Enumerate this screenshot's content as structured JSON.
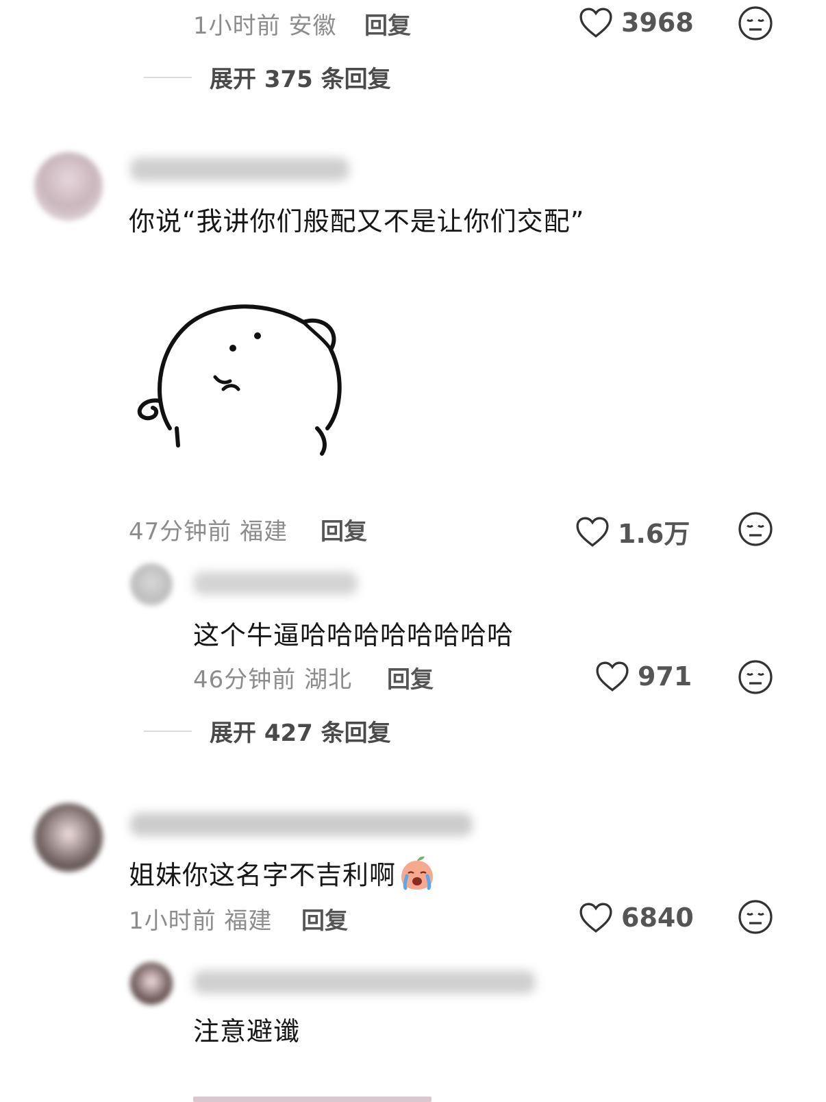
{
  "thread1": {
    "meta": "1小时前 安徽",
    "reply": "回复",
    "likes": "3968",
    "expand": "展开 375 条回复"
  },
  "comment2": {
    "text": "你说“我讲你们般配又不是让你们交配”",
    "meta": "47分钟前 福建",
    "reply": "回复",
    "likes": "1.6万",
    "sticker_icon": "bear-sticker"
  },
  "reply2": {
    "text": "这个牛逼哈哈哈哈哈哈哈哈",
    "meta": "46分钟前 湖北",
    "reply": "回复",
    "likes": "971",
    "expand": "展开 427 条回复"
  },
  "comment3": {
    "text": "姐妹你这名字不吉利啊",
    "emoji_icon": "crying-peach-emoji",
    "meta": "1小时前 福建",
    "reply": "回复",
    "likes": "6840"
  },
  "reply3": {
    "text": "注意避谶"
  },
  "icons": {
    "like": "heart-outline-icon",
    "dislike": "meh-face-icon"
  },
  "colors": {
    "background": "#ffffff",
    "text": "#161616",
    "meta": "#8c8c8c"
  }
}
